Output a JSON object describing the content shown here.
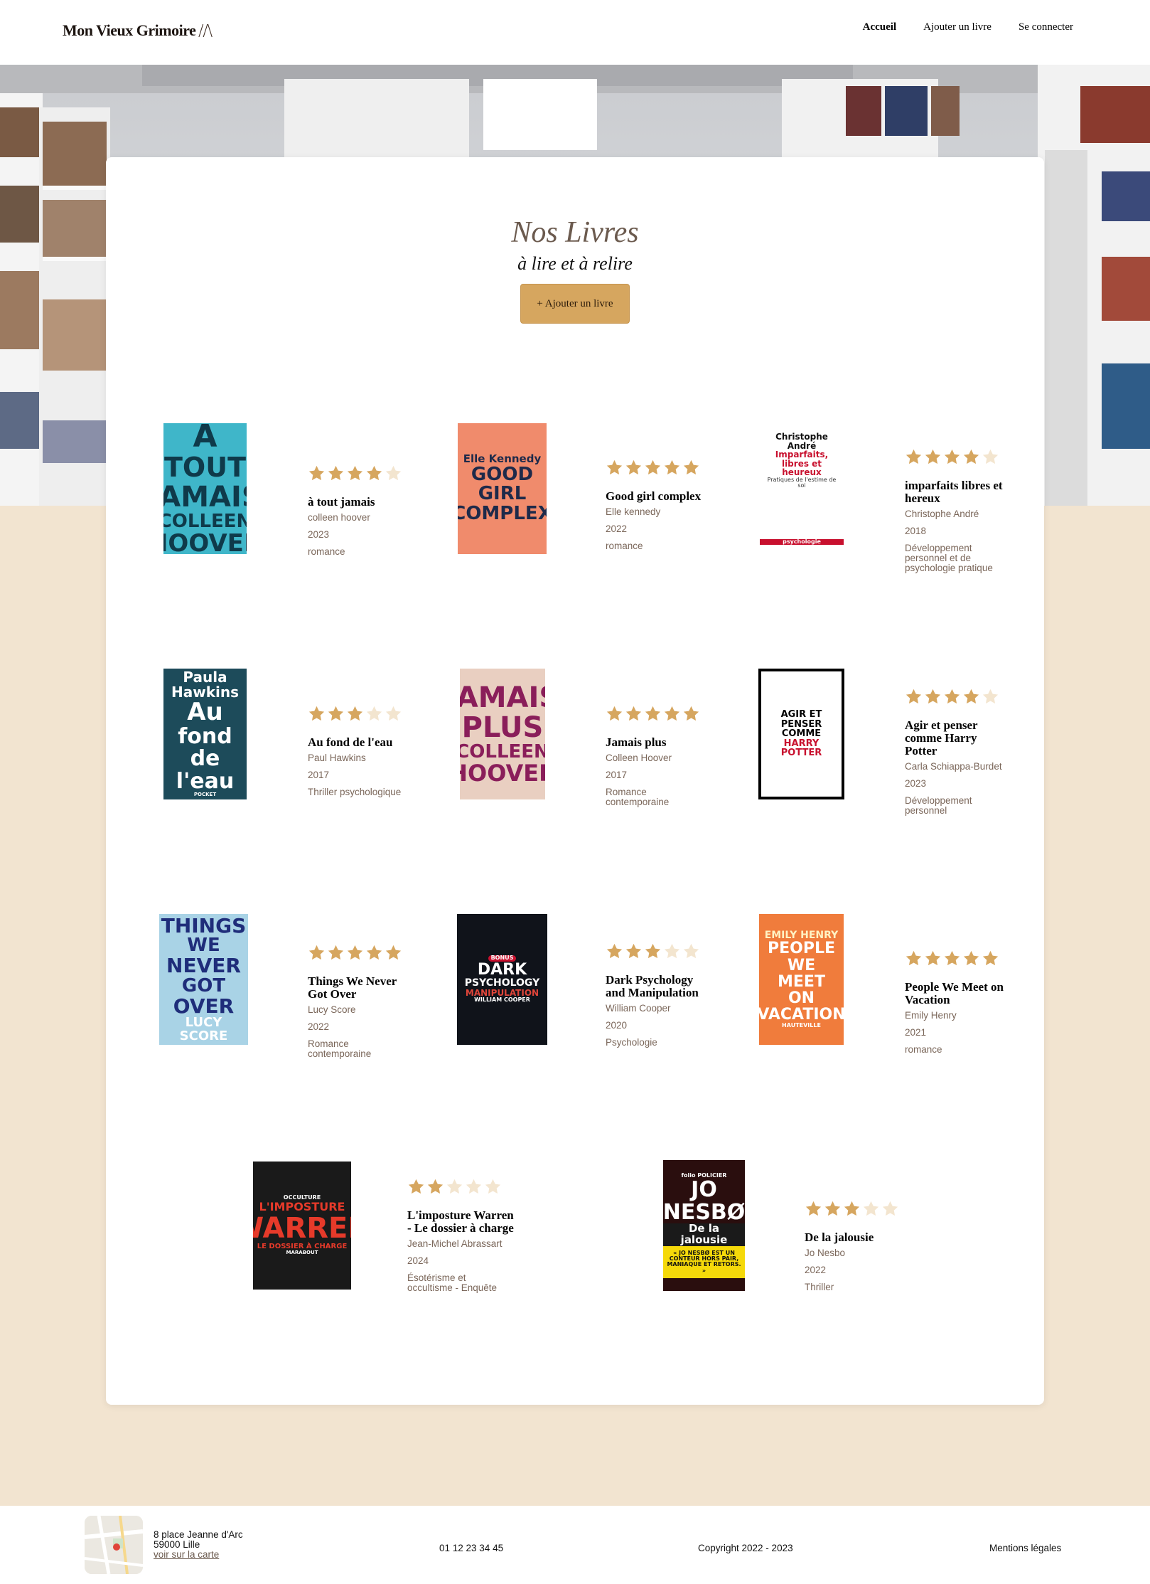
{
  "header": {
    "logo": "Mon Vieux Grimoire",
    "nav": [
      {
        "label": "Accueil",
        "active": true
      },
      {
        "label": "Ajouter un livre",
        "active": false
      },
      {
        "label": "Se connecter",
        "active": false
      }
    ]
  },
  "main": {
    "title": "Nos Livres",
    "subtitle": "à lire et à relire",
    "add_button": "+ Ajouter un livre"
  },
  "books": [
    {
      "title": "à tout jamais",
      "author": "colleen hoover",
      "year": "2023",
      "genre": "romance",
      "rating": 4
    },
    {
      "title": "Good girl complex",
      "author": "Elle kennedy",
      "year": "2022",
      "genre": "romance",
      "rating": 5
    },
    {
      "title": "imparfaits libres et hereux",
      "author": "Christophe André",
      "year": "2018",
      "genre": "Développement personnel et de psychologie pratique",
      "rating": 4
    },
    {
      "title": "Au fond de l'eau",
      "author": "Paul Hawkins",
      "year": "2017",
      "genre": "Thriller psychologique",
      "rating": 3
    },
    {
      "title": "Jamais plus",
      "author": "Colleen Hoover",
      "year": "2017",
      "genre": "Romance contemporaine",
      "rating": 5
    },
    {
      "title": "Agir et penser comme Harry Potter",
      "author": "Carla Schiappa-Burdet",
      "year": "2023",
      "genre": "Développement personnel",
      "rating": 4
    },
    {
      "title": "Things We Never Got Over",
      "author": "Lucy Score",
      "year": "2022",
      "genre": "Romance contemporaine",
      "rating": 5
    },
    {
      "title": "Dark Psychology and Manipulation",
      "author": "William Cooper",
      "year": "2020",
      "genre": "Psychologie",
      "rating": 3
    },
    {
      "title": "People We Meet on Vacation",
      "author": "Emily Henry",
      "year": "2021",
      "genre": "romance",
      "rating": 5
    },
    {
      "title": "L'imposture Warren - Le dossier à charge",
      "author": "Jean-Michel Abrassart",
      "year": "2024",
      "genre": "Ésotérisme et occultisme - Enquête",
      "rating": 2
    },
    {
      "title": "De la jalousie",
      "author": "Jo Nesbo",
      "year": "2022",
      "genre": "Thriller",
      "rating": 3
    }
  ],
  "covers": [
    {
      "lines": [
        "À",
        "TOUT",
        "JAMAIS",
        "COLLEEN",
        "HOOVER"
      ],
      "bg": "#3fb6c9",
      "fg": "#0f3a4a"
    },
    {
      "lines": [
        "Elle Kennedy",
        "GOOD GIRL",
        "COMPLEX"
      ],
      "bg": "#f08b6c",
      "fg": "#1e2a4a"
    },
    {
      "lines": [
        "Christophe André",
        "Imparfaits,",
        "libres et heureux",
        "Pratiques de l'estime de soi",
        "psychologie"
      ],
      "bg": "#ffffff",
      "fg": "#c8102e"
    },
    {
      "lines": [
        "Paula Hawkins",
        "Au",
        "fond de",
        "l'eau",
        "POCKET"
      ],
      "bg": "#1d4b5a",
      "fg": "#ffffff"
    },
    {
      "lines": [
        "JAMAIS",
        "PLUS",
        "COLLEEN",
        "HOOVER"
      ],
      "bg": "#e9cfc1",
      "fg": "#8a1e5a"
    },
    {
      "lines": [
        "AGIR ET PENSER",
        "COMME",
        "HARRY POTTER"
      ],
      "bg": "#ffffff",
      "fg": "#000000"
    },
    {
      "lines": [
        "THINGS",
        "WE",
        "NEVER",
        "GOT",
        "OVER",
        "LUCY SCORE"
      ],
      "bg": "#a9d3e6",
      "fg": "#1f2d7a"
    },
    {
      "lines": [
        "BONUS",
        "DARK",
        "PSYCHOLOGY",
        "MANIPULATION",
        "WILLIAM COOPER"
      ],
      "bg": "#10131a",
      "fg": "#ffffff"
    },
    {
      "lines": [
        "EMILY HENRY",
        "PEOPLE WE",
        "MEET ON",
        "VACATION",
        "HAUTEVILLE"
      ],
      "bg": "#f07c3c",
      "fg": "#ffffff"
    },
    {
      "lines": [
        "OCCULTURE",
        "L'IMPOSTURE",
        "WARREN",
        "LE DOSSIER À CHARGE",
        "MARABOUT"
      ],
      "bg": "#1a1a1a",
      "fg": "#e63a2a"
    },
    {
      "lines": [
        "folio POLICIER",
        "JO",
        "NESBØ",
        "De la jalousie",
        "« JO NESBØ EST UN CONTEUR HORS PAIR, MANIAQUE ET RETORS. »"
      ],
      "bg": "#2a0e0e",
      "fg": "#ffffff"
    }
  ],
  "footer": {
    "address_line1": "8 place Jeanne d'Arc",
    "address_line2": "59000 Lille",
    "map_link": "voir sur la carte",
    "phone": "01 12 23 34 45",
    "copyright": "Copyright 2022 - 2023",
    "legal": "Mentions légales"
  },
  "colors": {
    "accent": "#d6a65f",
    "star_filled": "#d6a65f",
    "star_empty": "#f3e5cf",
    "beige_bg": "#f2e4d0",
    "meta_text": "#7a6659"
  }
}
